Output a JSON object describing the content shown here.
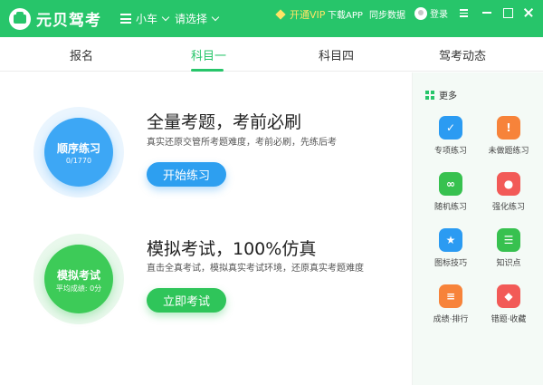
{
  "app": {
    "name": "元贝驾考"
  },
  "topbar": {
    "vehicle": "小车",
    "select": "请选择",
    "vip": "开通VIP",
    "download": "下载APP",
    "sync": "同步数据",
    "login": "登录"
  },
  "tabs": [
    {
      "label": "报名"
    },
    {
      "label": "科目一"
    },
    {
      "label": "科目四"
    },
    {
      "label": "驾考动态"
    }
  ],
  "practice": {
    "bubble_title": "顺序练习",
    "progress": "0/1770",
    "title": "全量考题，考前必刷",
    "desc": "真实还原交管所考题难度，考前必刷，先练后考",
    "button": "开始练习"
  },
  "exam": {
    "bubble_title": "模拟考试",
    "score": "平均成绩: 0分",
    "title": "模拟考试，100%仿真",
    "desc": "直击全真考试，模拟真实考试环境，还原真实考题难度",
    "button": "立即考试"
  },
  "sidebar": {
    "title": "更多",
    "items": [
      {
        "label": "专项练习",
        "icon": "checklist-icon",
        "color": "#2b9bf2"
      },
      {
        "label": "未做题练习",
        "icon": "exclamation-icon",
        "color": "#f7833a"
      },
      {
        "label": "随机练习",
        "icon": "shuffle-icon",
        "color": "#37c14f"
      },
      {
        "label": "强化练习",
        "icon": "target-icon",
        "color": "#f25a57"
      },
      {
        "label": "图标技巧",
        "icon": "star-icon",
        "color": "#2b9bf2"
      },
      {
        "label": "知识点",
        "icon": "book-icon",
        "color": "#37c14f"
      },
      {
        "label": "成绩·排行",
        "icon": "ranking-icon",
        "color": "#f7833a"
      },
      {
        "label": "错题·收藏",
        "icon": "tag-icon",
        "color": "#f25a57"
      }
    ]
  },
  "colors": {
    "brand": "#27c56a",
    "blue": "#2d9ff0",
    "green": "#2fc55a",
    "vip": "#ffe466"
  }
}
